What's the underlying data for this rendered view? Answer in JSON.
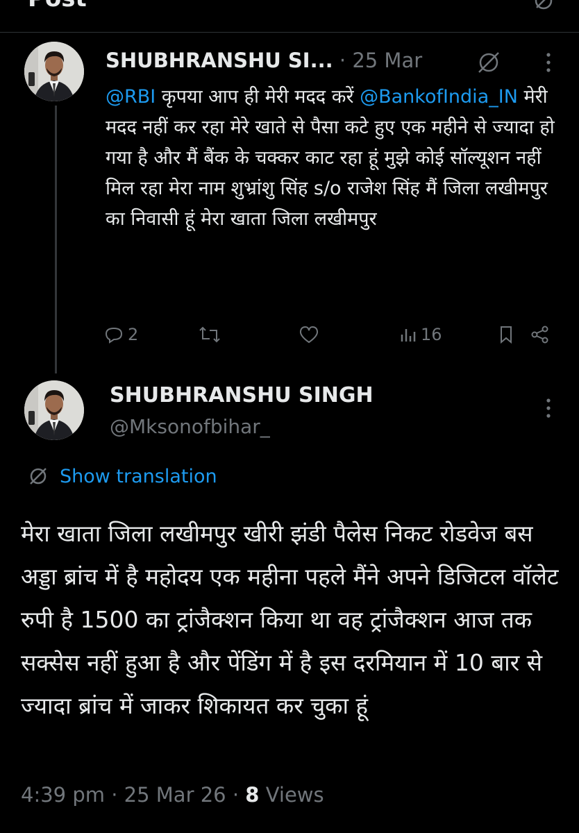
{
  "header": {
    "title": "Post"
  },
  "post1": {
    "author_name": "SHUBHRANSHU SI...",
    "separator": "·",
    "date": "25 Mar",
    "mention_1": "@RBI",
    "text_1": " कृपया आप ही मेरी मदद करें ",
    "mention_2": "@BankofIndia_IN",
    "text_2": " मेरी मदद नहीं कर रहा मेरे खाते से पैसा कटे हुए एक महीने से ज्यादा हो गया है और मैं बैंक के चक्कर काट रहा हूं मुझे कोई सॉल्यूशन नहीं मिल रहा मेरा नाम शुभ्रांशु सिंह s/o राजेश सिंह मैं जिला लखीमपुर का निवासी हूं मेरा खाता जिला लखीमपुर",
    "replies": "2",
    "views": "16"
  },
  "post2": {
    "author_name": "SHUBHRANSHU SINGH",
    "handle": "@Mksonofbihar_",
    "show_translation": "Show translation",
    "text": "मेरा खाता जिला लखीमपुर खीरी झंडी पैलेस निकट रोडवेज बस अड्डा ब्रांच में है महोदय एक महीना पहले मैंने अपने डिजिटल वॉलेट रुपी है 1500 का ट्रांजैक्शन किया था वह ट्रांजैक्शन आज तक सक्सेस नहीं हुआ है और  पेंडिंग में है इस दरमियान में 10 बार से ज्यादा ब्रांच में जाकर शिकायत कर चुका हूं",
    "time": "4:39 pm",
    "separator": "·",
    "date": "25 Mar 26",
    "views_count": "8",
    "views_label": "Views"
  },
  "colors": {
    "accent": "#1d9bf0",
    "muted": "#71767b",
    "text": "#e7e9ea",
    "background": "#000000"
  }
}
